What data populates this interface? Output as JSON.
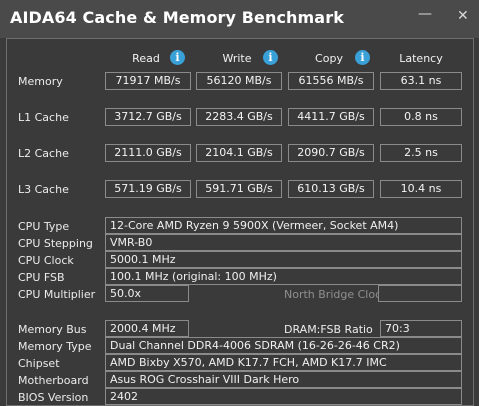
{
  "window": {
    "title": "AIDA64 Cache & Memory Benchmark"
  },
  "columns": {
    "read": "Read",
    "write": "Write",
    "copy": "Copy",
    "latency": "Latency"
  },
  "rows": [
    {
      "label": "Memory",
      "read": "71917 MB/s",
      "write": "56120 MB/s",
      "copy": "61556 MB/s",
      "latency": "63.1 ns"
    },
    {
      "label": "L1 Cache",
      "read": "3712.7 GB/s",
      "write": "2283.4 GB/s",
      "copy": "4411.7 GB/s",
      "latency": "0.8 ns"
    },
    {
      "label": "L2 Cache",
      "read": "2111.0 GB/s",
      "write": "2104.1 GB/s",
      "copy": "2090.7 GB/s",
      "latency": "2.5 ns"
    },
    {
      "label": "L3 Cache",
      "read": "571.19 GB/s",
      "write": "591.71 GB/s",
      "copy": "610.13 GB/s",
      "latency": "10.4 ns"
    }
  ],
  "cpu": {
    "type_label": "CPU Type",
    "type": "12-Core AMD Ryzen 9 5900X  (Vermeer, Socket AM4)",
    "stepping_label": "CPU Stepping",
    "stepping": "VMR-B0",
    "clock_label": "CPU Clock",
    "clock": "5000.1 MHz",
    "fsb_label": "CPU FSB",
    "fsb": "100.1 MHz  (original: 100 MHz)",
    "multiplier_label": "CPU Multiplier",
    "multiplier": "50.0x",
    "north_bridge_label": "North Bridge Clock"
  },
  "system": {
    "memory_bus_label": "Memory Bus",
    "memory_bus": "2000.4 MHz",
    "dram_fsb_label": "DRAM:FSB Ratio",
    "dram_fsb": "70:3",
    "memory_type_label": "Memory Type",
    "memory_type": "Dual Channel DDR4-4006 SDRAM  (16-26-26-46 CR2)",
    "chipset_label": "Chipset",
    "chipset": "AMD Bixby X570, AMD K17.7 FCH, AMD K17.7 IMC",
    "motherboard_label": "Motherboard",
    "motherboard": "Asus ROG Crosshair VIII Dark Hero",
    "bios_label": "BIOS Version",
    "bios": "2402"
  },
  "icons": {
    "info": "info-icon",
    "minimize": "minimize-icon",
    "close": "close-icon"
  },
  "colors": {
    "background": "#3b3b3b",
    "info_icon": "#3aa0d8",
    "box_border": "#8a8a8a"
  }
}
